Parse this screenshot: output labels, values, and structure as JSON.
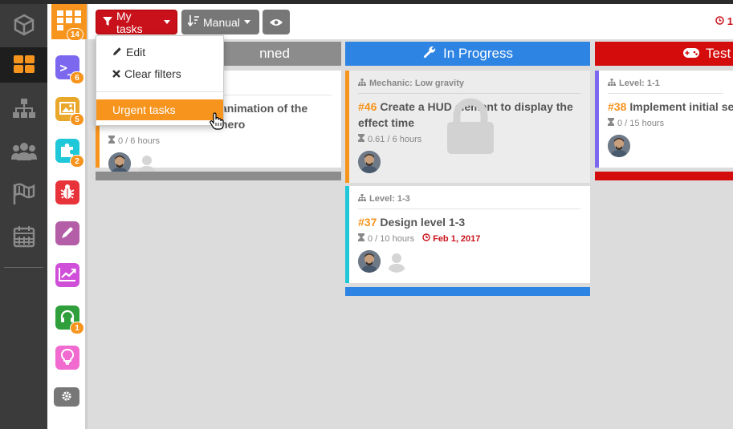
{
  "sidebar": {
    "items": [
      {
        "icon": "cube-icon",
        "active": false
      },
      {
        "icon": "grid-icon",
        "active": true
      },
      {
        "icon": "hierarchy-icon",
        "active": false
      },
      {
        "icon": "users-icon",
        "active": false
      },
      {
        "icon": "flags-icon",
        "active": false
      },
      {
        "icon": "calendar-icon",
        "active": false
      }
    ]
  },
  "apps": {
    "items": [
      {
        "icon": "grid-icon",
        "color": "#f7941d",
        "badge": "14"
      },
      {
        "icon": "terminal-icon",
        "color": "#7b68ee",
        "badge": "6"
      },
      {
        "icon": "image-icon",
        "color": "#e9a82a",
        "badge": "5"
      },
      {
        "icon": "puzzle-icon",
        "color": "#1ec8d8",
        "badge": "2"
      },
      {
        "icon": "bug-icon",
        "color": "#e8333b",
        "badge": ""
      },
      {
        "icon": "pencil-icon",
        "color": "#b45ea8",
        "badge": ""
      },
      {
        "icon": "chart-icon",
        "color": "#d04fd8",
        "badge": ""
      },
      {
        "icon": "headset-icon",
        "color": "#2e9f3a",
        "badge": "1"
      },
      {
        "icon": "lightbulb-icon",
        "color": "#f06ad0",
        "badge": ""
      },
      {
        "icon": "gear-icon",
        "color": "#777777",
        "badge": ""
      }
    ]
  },
  "toolbar": {
    "my_tasks_label": "My tasks",
    "manual_label": "Manual",
    "right_text": "1"
  },
  "dropdown": {
    "edit_label": "Edit",
    "clear_filters_label": "Clear filters",
    "urgent_tasks_label": "Urgent tasks"
  },
  "columns": [
    {
      "title": "nned",
      "color": "#8c8c8c",
      "icon": "none"
    },
    {
      "title": "In Progress",
      "color": "#2d84e3",
      "icon": "wrench-icon"
    },
    {
      "title": "Test",
      "color": "#d40c0c",
      "icon": "gamepad-icon"
    }
  ],
  "cards": {
    "planned_1": {
      "title_fragment": "animation of the hero",
      "hours": "0 / 6 hours",
      "accent": "#f7941d"
    },
    "progress_1": {
      "context": "Mechanic: Low gravity",
      "id": "#46",
      "title": "Create a HUD element to display the effect time",
      "hours": "0.61 / 6 hours",
      "accent": "#f7941d"
    },
    "progress_2": {
      "context": "Level: 1-3",
      "id": "#37",
      "title": "Design level 1-3",
      "hours": "0 / 10 hours",
      "due": "Feb 1, 2017",
      "accent": "#1ec8d8"
    },
    "test_1": {
      "context": "Level: 1-1",
      "id": "#38",
      "title": "Implement initial sequ",
      "hours": "0 / 15 hours",
      "accent": "#7b68ee"
    }
  }
}
